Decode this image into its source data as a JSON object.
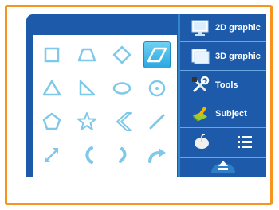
{
  "menu": {
    "items": [
      {
        "label": "2D graphic",
        "icon": "2d-graphic-icon"
      },
      {
        "label": "3D graphic",
        "icon": "3d-graphic-icon"
      },
      {
        "label": "Tools",
        "icon": "tools-icon"
      },
      {
        "label": "Subject",
        "icon": "subject-icon"
      }
    ],
    "bottom_icons": [
      "mouse-icon",
      "list-icon"
    ],
    "eject_icon": "eject-icon"
  },
  "shapes": {
    "selected": "parallelogram",
    "items": [
      "square",
      "trapezoid",
      "diamond",
      "parallelogram",
      "triangle",
      "right-triangle",
      "ellipse",
      "circle",
      "pentagon",
      "star",
      "chevron",
      "line",
      "double-arrow",
      "arc",
      "curve",
      "curved-arrow"
    ]
  },
  "colors": {
    "frame": "#f7941d",
    "window": "#1d5aa9",
    "shape_stroke": "#7ec8ea",
    "selected": "#2aa8e0"
  }
}
